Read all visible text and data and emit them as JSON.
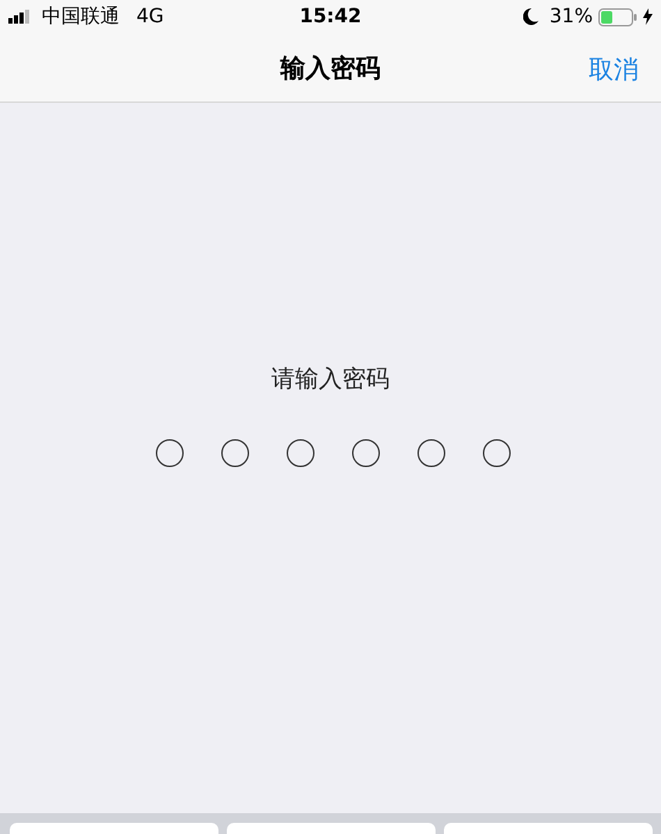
{
  "status_bar": {
    "carrier": "中国联通",
    "network": "4G",
    "time": "15:42",
    "battery": "31%",
    "charging": true
  },
  "nav_bar": {
    "title": "输入密码",
    "cancel": "取消"
  },
  "prompt": "请输入密码",
  "passcode_dots": [
    {
      "filled": false
    },
    {
      "filled": false
    },
    {
      "filled": false
    },
    {
      "filled": false
    },
    {
      "filled": false
    },
    {
      "filled": false
    }
  ]
}
